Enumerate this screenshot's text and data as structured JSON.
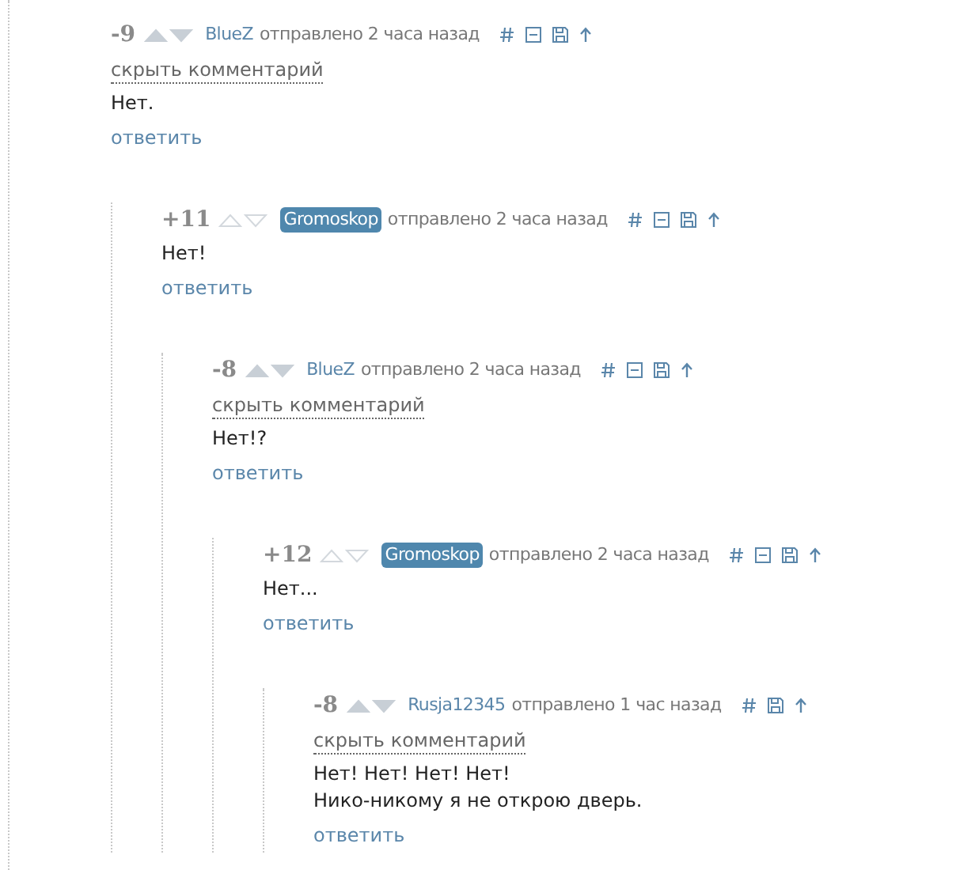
{
  "comments": [
    {
      "score": "-9",
      "arrows_filled": true,
      "author": "BlueZ",
      "op": false,
      "posted": "отправлено 2 часа назад",
      "collapse_icon": true,
      "hide_link": "скрыть комментарий",
      "text": "Нет.",
      "reply": "ответить",
      "children": [
        {
          "score": "+11",
          "arrows_filled": false,
          "author": "Gromoskop",
          "op": true,
          "posted": "отправлено 2 часа назад",
          "collapse_icon": true,
          "text": "Нет!",
          "reply": "ответить",
          "children": [
            {
              "score": "-8",
              "arrows_filled": true,
              "author": "BlueZ",
              "op": false,
              "posted": "отправлено 2 часа назад",
              "collapse_icon": true,
              "hide_link": "скрыть комментарий",
              "text": "Нет!?",
              "reply": "ответить",
              "children": [
                {
                  "score": "+12",
                  "arrows_filled": false,
                  "author": "Gromoskop",
                  "op": true,
                  "posted": "отправлено 2 часа назад",
                  "collapse_icon": true,
                  "text": "Нет...",
                  "reply": "ответить",
                  "children": [
                    {
                      "score": "-8",
                      "arrows_filled": true,
                      "author": "Rusja12345",
                      "op": false,
                      "posted": "отправлено 1 час назад",
                      "collapse_icon": false,
                      "hide_link": "скрыть комментарий",
                      "text": "Нет! Нет! Нет! Нет!\nНико-никому я не открою дверь.",
                      "reply": "ответить"
                    }
                  ]
                }
              ]
            }
          ]
        }
      ]
    }
  ]
}
